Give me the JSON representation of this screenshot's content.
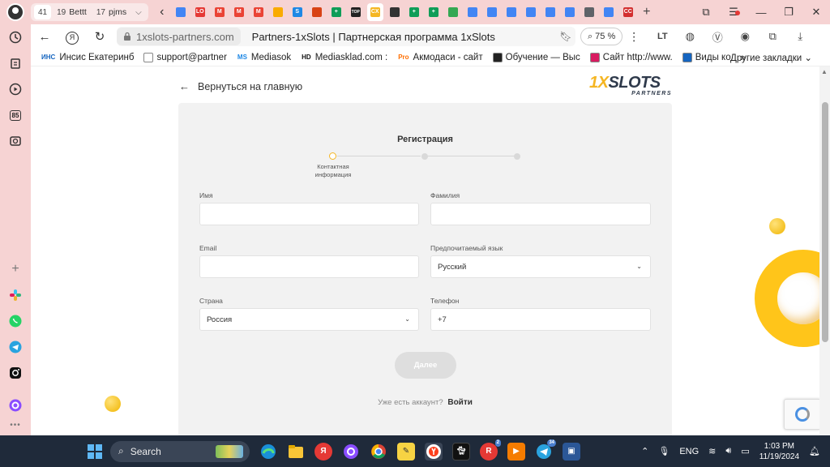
{
  "tabstrip": {
    "groups": [
      {
        "count": "41",
        "label": ""
      },
      {
        "count": "19",
        "label": "Bettt"
      },
      {
        "count": "17",
        "label": "pjms"
      }
    ],
    "favicons": [
      {
        "name": "docs-favicon",
        "color": "#4285f4",
        "glyph": ""
      },
      {
        "name": "lo-favicon",
        "color": "#e53935",
        "glyph": "LO"
      },
      {
        "name": "gmail-favicon",
        "color": "#ea4335",
        "glyph": "M"
      },
      {
        "name": "gmail-favicon",
        "color": "#ea4335",
        "glyph": "M"
      },
      {
        "name": "gmail-favicon",
        "color": "#ea4335",
        "glyph": "M"
      },
      {
        "name": "analytics-favicon",
        "color": "#f9ab00",
        "glyph": ""
      },
      {
        "name": "s-favicon",
        "color": "#1e88e5",
        "glyph": "S"
      },
      {
        "name": "headphones-favicon",
        "color": "#d84315",
        "glyph": ""
      },
      {
        "name": "plus-favicon",
        "color": "#0f9d58",
        "glyph": "+"
      },
      {
        "name": "top-favicon",
        "color": "#222222",
        "glyph": "TOP"
      },
      {
        "name": "cx-favicon",
        "color": "#f5b623",
        "glyph": "CX"
      },
      {
        "name": "arrow-favicon",
        "color": "#333333",
        "glyph": ""
      },
      {
        "name": "plus-favicon",
        "color": "#0f9d58",
        "glyph": "+"
      },
      {
        "name": "plus-favicon",
        "color": "#0f9d58",
        "glyph": "+"
      },
      {
        "name": "drive-favicon",
        "color": "#34a853",
        "glyph": ""
      },
      {
        "name": "docs-favicon",
        "color": "#4285f4",
        "glyph": ""
      },
      {
        "name": "docs-favicon",
        "color": "#4285f4",
        "glyph": ""
      },
      {
        "name": "docs-favicon",
        "color": "#4285f4",
        "glyph": ""
      },
      {
        "name": "docs-favicon",
        "color": "#4285f4",
        "glyph": ""
      },
      {
        "name": "docs-favicon",
        "color": "#4285f4",
        "glyph": ""
      },
      {
        "name": "docs-favicon",
        "color": "#4285f4",
        "glyph": ""
      },
      {
        "name": "file-favicon",
        "color": "#5f6368",
        "glyph": ""
      },
      {
        "name": "docs-favicon",
        "color": "#4285f4",
        "glyph": ""
      },
      {
        "name": "cc-favicon",
        "color": "#d32f2f",
        "glyph": "CC"
      }
    ]
  },
  "address": {
    "domain": "1xslots-partners.com",
    "page_title": "Partners-1xSlots | Партнерская программа 1xSlots",
    "zoom": "75 %"
  },
  "bookmarks": {
    "items": [
      {
        "label": "Инсис Екатеринб",
        "icon_text": "ИНС",
        "color": "#1565c0"
      },
      {
        "label": "support@partner",
        "icon_text": "",
        "color": "#ffffff"
      },
      {
        "label": "Mediasok",
        "icon_text": "MS",
        "color": "#1e88e5"
      },
      {
        "label": "Mediasklad.com :",
        "icon_text": "HD",
        "color": "#111111"
      },
      {
        "label": "Акмодаси - сайт",
        "icon_text": "Pro",
        "color": "#ff6f00"
      },
      {
        "label": "Обучение — Выс",
        "icon_text": "",
        "color": "#222222"
      },
      {
        "label": "Сайт http://www.",
        "icon_text": "",
        "color": "#d81b60"
      },
      {
        "label": "Виды ко",
        "icon_text": "",
        "color": "#1565c0"
      }
    ],
    "more": "»",
    "other": "Другие закладки"
  },
  "form": {
    "back_label": "Вернуться на главную",
    "logo_main": "1XSLOTS",
    "logo_sub": "PARTNERS",
    "title": "Регистрация",
    "step_label": "Контактная информация",
    "first_name_label": "Имя",
    "last_name_label": "Фамилия",
    "email_label": "Email",
    "language_label": "Предпочитаемый язык",
    "language_value": "Русский",
    "country_label": "Страна",
    "country_value": "Россия",
    "phone_label": "Телефон",
    "phone_value": "+7",
    "next_button": "Далее",
    "have_account": "Уже есть аккаунт?",
    "login_link": "Войти"
  },
  "sidebar": {
    "badge": "85"
  },
  "taskbar": {
    "search_placeholder": "Search",
    "lang": "ENG",
    "time": "1:03 PM",
    "date": "11/19/2024",
    "telegram_badge": "34",
    "r_badge": "2"
  },
  "colors": {
    "accent": "#f5b623",
    "browser_chrome": "#f6d3d3",
    "taskbar": "#1f2a3a"
  }
}
